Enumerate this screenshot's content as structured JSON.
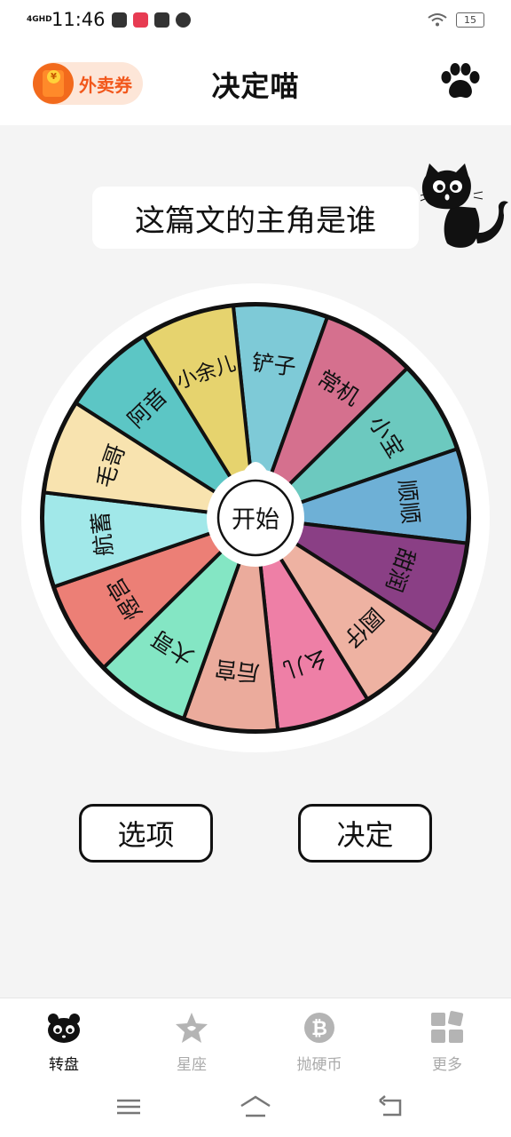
{
  "status_bar": {
    "network": "4GHD",
    "time": "11:46",
    "battery": "15"
  },
  "header": {
    "coupon_label": "外卖券",
    "title": "决定喵"
  },
  "question": "这篇文的主角是谁",
  "wheel": {
    "center_label": "开始",
    "segments": [
      {
        "label": "铲子",
        "color": "#7ecad7"
      },
      {
        "label": "常机",
        "color": "#d5708e"
      },
      {
        "label": "小宝",
        "color": "#6cc9bf"
      },
      {
        "label": "顺顺",
        "color": "#6eb0d6"
      },
      {
        "label": "甜润",
        "color": "#8a3f85"
      },
      {
        "label": "圆仔",
        "color": "#eeb2a2"
      },
      {
        "label": "幺儿",
        "color": "#ee7fa6"
      },
      {
        "label": "后宫",
        "color": "#ebab9c"
      },
      {
        "label": "大哥",
        "color": "#84e6c4"
      },
      {
        "label": "煜宫",
        "color": "#ec7f76"
      },
      {
        "label": "航蓄",
        "color": "#a1e8e9"
      },
      {
        "label": "毛哥",
        "color": "#f8e3af"
      },
      {
        "label": "阿音",
        "color": "#5cc6c5"
      },
      {
        "label": "小余儿",
        "color": "#e6d36e"
      }
    ]
  },
  "buttons": {
    "options": "选项",
    "decide": "决定"
  },
  "nav": [
    {
      "label": "转盘",
      "icon": "cat-face-icon",
      "active": true
    },
    {
      "label": "星座",
      "icon": "star-icon",
      "active": false
    },
    {
      "label": "抛硬币",
      "icon": "bitcoin-icon",
      "active": false
    },
    {
      "label": "更多",
      "icon": "grid-icon",
      "active": false
    }
  ],
  "colors": {
    "accent_orange": "#f2581c",
    "background": "#f4f4f4"
  }
}
